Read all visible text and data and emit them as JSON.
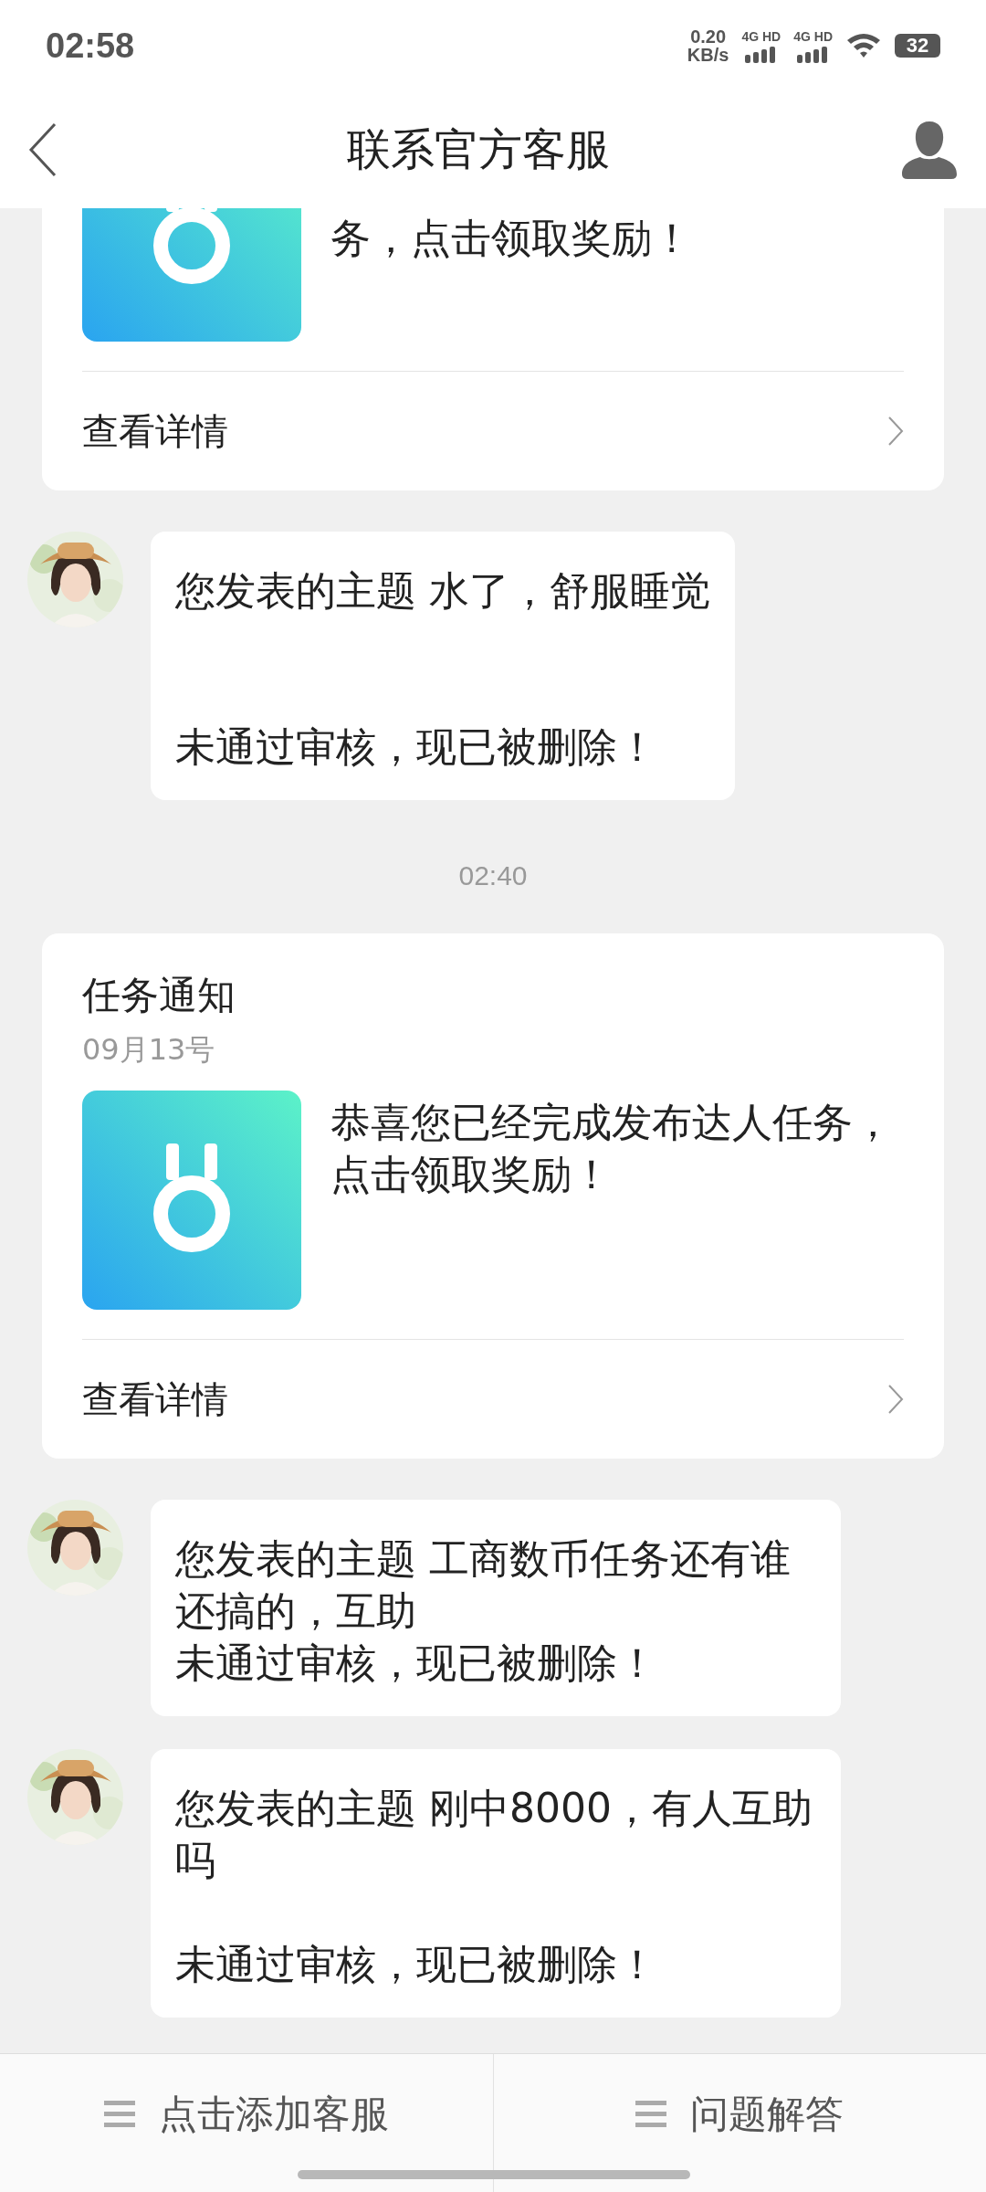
{
  "status_bar": {
    "time": "02:58",
    "net_speed": "0.20",
    "net_unit": "KB/s",
    "sim_labels": [
      "4G HD",
      "4G HD"
    ],
    "battery": "32"
  },
  "header": {
    "title": "联系官方客服"
  },
  "messages": [
    {
      "kind": "task_card_clipped",
      "body": "务，点击领取奖励！",
      "link": "查看详情"
    },
    {
      "kind": "bubble_wide_gap",
      "topic": "您发表的主题 水了，舒服睡觉",
      "status": "未通过审核，现已被删除！"
    },
    {
      "kind": "time",
      "text": "02:40"
    },
    {
      "kind": "task_card",
      "title": "任务通知",
      "date": "09月13号",
      "body": "恭喜您已经完成发布达人任务，点击领取奖励！",
      "link": "查看详情"
    },
    {
      "kind": "bubble",
      "topic": "您发表的主题 工商数币任务还有谁还搞的，互助",
      "status": "未通过审核，现已被删除！"
    },
    {
      "kind": "bubble_gap",
      "topic": "您发表的主题 刚中8000，有人互助吗",
      "status": "未通过审核，现已被删除！"
    }
  ],
  "bottom_bar": {
    "buttons": [
      "点击添加客服",
      "问题解答"
    ]
  }
}
